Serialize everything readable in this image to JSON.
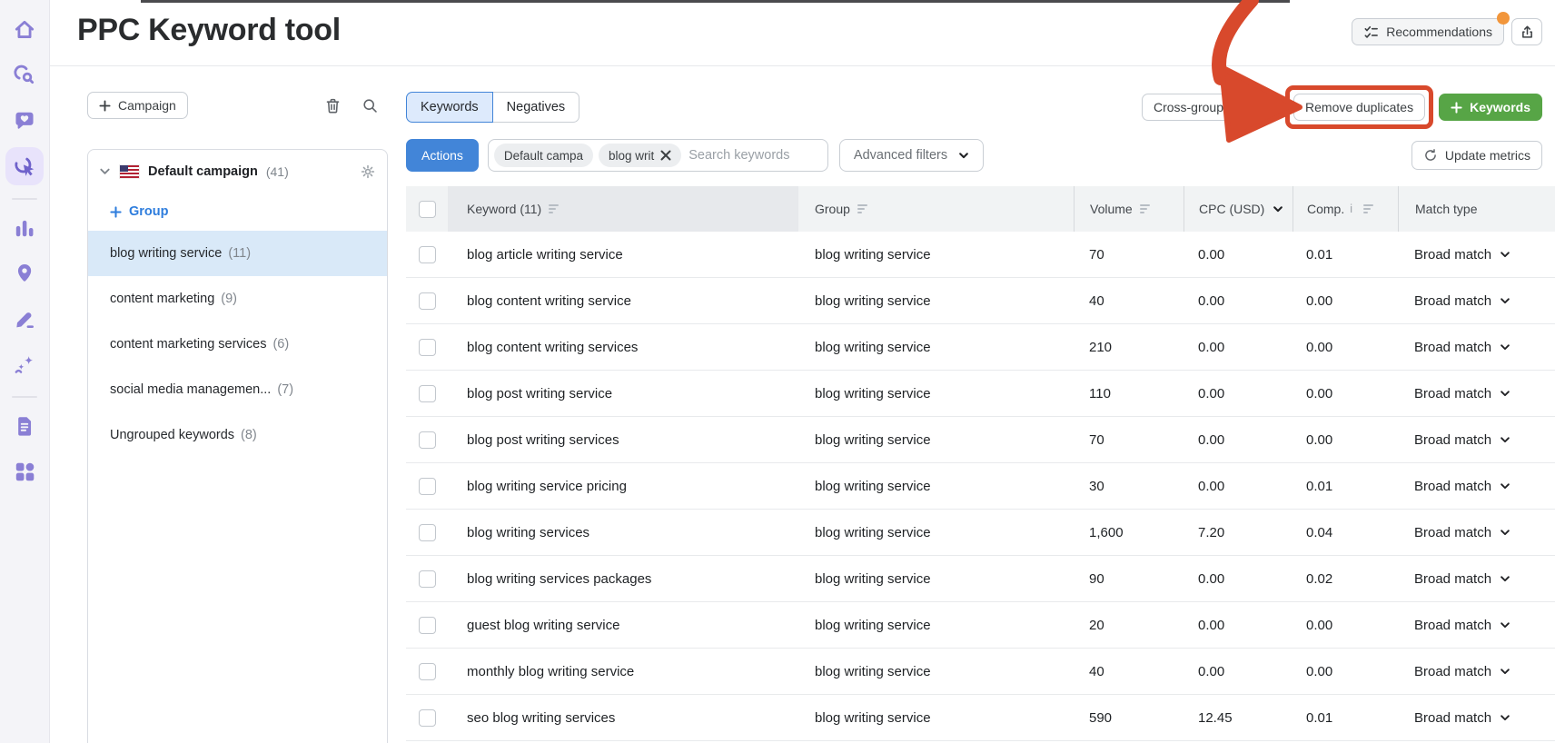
{
  "page_title": "PPC Keyword tool",
  "header": {
    "recommendations_label": "Recommendations",
    "notification_dot_color": "#f2963b",
    "export_icon": "export-upload-icon"
  },
  "sidebar": {
    "selected_item": "ppc-keyword-tool",
    "icons": [
      "home-icon",
      "research-icon",
      "engagement-heart-bubble-icon",
      "ppc-click-target-icon",
      "bar-chart-icon",
      "location-pin-icon",
      "content-pencil-icon",
      "ai-sparkles-icon",
      "reports-document-icon",
      "apps-grid-icon"
    ]
  },
  "left_panel": {
    "add_campaign_label": "Campaign",
    "toolbar_icons": [
      "trash-icon",
      "search-icon"
    ],
    "campaign": {
      "flag": "us-flag",
      "name": "Default campaign",
      "count": "(41)"
    },
    "add_group_label": "Group",
    "groups": [
      {
        "name": "blog writing service",
        "count": "(11)",
        "selected": true
      },
      {
        "name": "content marketing",
        "count": "(9)",
        "selected": false
      },
      {
        "name": "content marketing services",
        "count": "(6)",
        "selected": false
      },
      {
        "name": "social media managemen...",
        "count": "(7)",
        "selected": false
      },
      {
        "name": "Ungrouped keywords",
        "count": "(8)",
        "selected": false
      }
    ]
  },
  "toolbar": {
    "tabs": [
      "Keywords",
      "Negatives"
    ],
    "active_tab": "Keywords",
    "cross_group_negatives_label": "Cross-group negativ",
    "remove_duplicates_label": "Remove duplicates",
    "add_keywords_label": "Keywords",
    "actions_label": "Actions",
    "filter_chips": [
      "Default campa",
      "blog writ"
    ],
    "search_placeholder": "Search keywords",
    "advanced_filters_label": "Advanced filters",
    "update_metrics_label": "Update metrics"
  },
  "table": {
    "columns": {
      "keyword": "Keyword (11)",
      "group": "Group",
      "volume": "Volume",
      "cpc": "CPC (USD)",
      "comp": "Comp.",
      "match": "Match type"
    },
    "rows": [
      {
        "keyword": "blog article writing service",
        "group": "blog writing service",
        "volume": "70",
        "cpc": "0.00",
        "comp": "0.01",
        "match": "Broad match"
      },
      {
        "keyword": "blog content writing service",
        "group": "blog writing service",
        "volume": "40",
        "cpc": "0.00",
        "comp": "0.00",
        "match": "Broad match"
      },
      {
        "keyword": "blog content writing services",
        "group": "blog writing service",
        "volume": "210",
        "cpc": "0.00",
        "comp": "0.00",
        "match": "Broad match"
      },
      {
        "keyword": "blog post writing service",
        "group": "blog writing service",
        "volume": "110",
        "cpc": "0.00",
        "comp": "0.00",
        "match": "Broad match"
      },
      {
        "keyword": "blog post writing services",
        "group": "blog writing service",
        "volume": "70",
        "cpc": "0.00",
        "comp": "0.00",
        "match": "Broad match"
      },
      {
        "keyword": "blog writing service pricing",
        "group": "blog writing service",
        "volume": "30",
        "cpc": "0.00",
        "comp": "0.01",
        "match": "Broad match"
      },
      {
        "keyword": "blog writing services",
        "group": "blog writing service",
        "volume": "1,600",
        "cpc": "7.20",
        "comp": "0.04",
        "match": "Broad match"
      },
      {
        "keyword": "blog writing services packages",
        "group": "blog writing service",
        "volume": "90",
        "cpc": "0.00",
        "comp": "0.02",
        "match": "Broad match"
      },
      {
        "keyword": "guest blog writing service",
        "group": "blog writing service",
        "volume": "20",
        "cpc": "0.00",
        "comp": "0.00",
        "match": "Broad match"
      },
      {
        "keyword": "monthly blog writing service",
        "group": "blog writing service",
        "volume": "40",
        "cpc": "0.00",
        "comp": "0.00",
        "match": "Broad match"
      },
      {
        "keyword": "seo blog writing services",
        "group": "blog writing service",
        "volume": "590",
        "cpc": "12.45",
        "comp": "0.01",
        "match": "Broad match"
      }
    ]
  },
  "colors": {
    "accent_blue": "#4285d8",
    "button_green": "#57a546",
    "annotation_red": "#d8492c",
    "sidebar_purple": "#8a7fd5",
    "notification_orange": "#f2963b"
  }
}
